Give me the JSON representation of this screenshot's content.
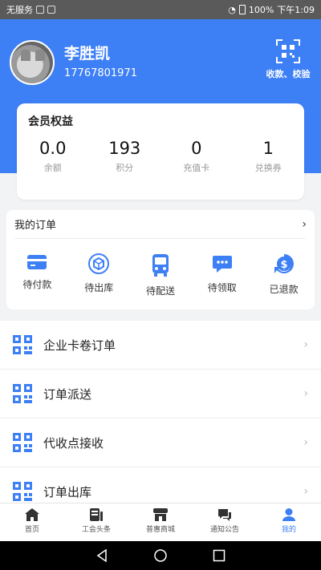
{
  "statusbar": {
    "carrier": "无服务",
    "battery": "100%",
    "time": "下午1:09"
  },
  "profile": {
    "name": "李胜凯",
    "phone": "17767801971"
  },
  "scan": {
    "label": "收款、校验"
  },
  "member": {
    "title": "会员权益",
    "stats": [
      {
        "value": "0.0",
        "label": "余额"
      },
      {
        "value": "193",
        "label": "积分"
      },
      {
        "value": "0",
        "label": "充值卡"
      },
      {
        "value": "1",
        "label": "兑换券"
      }
    ]
  },
  "orders": {
    "title": "我的订单",
    "items": [
      {
        "label": "待付款",
        "icon": "card-icon"
      },
      {
        "label": "待出库",
        "icon": "box-icon"
      },
      {
        "label": "待配送",
        "icon": "bus-icon"
      },
      {
        "label": "待领取",
        "icon": "chat-icon"
      },
      {
        "label": "已退款",
        "icon": "refund-icon"
      }
    ]
  },
  "list": [
    {
      "label": "企业卡卷订单"
    },
    {
      "label": "订单派送"
    },
    {
      "label": "代收点接收"
    },
    {
      "label": "订单出库"
    }
  ],
  "tabs": [
    {
      "label": "首页",
      "icon": "home-icon"
    },
    {
      "label": "工会头条",
      "icon": "news-icon"
    },
    {
      "label": "普惠商城",
      "icon": "store-icon"
    },
    {
      "label": "通知公告",
      "icon": "notice-icon"
    },
    {
      "label": "我的",
      "icon": "user-icon"
    }
  ],
  "colors": {
    "accent": "#3d7ff5",
    "header_bg": "#3d7ff5",
    "page_bg": "#f2f3f5"
  }
}
